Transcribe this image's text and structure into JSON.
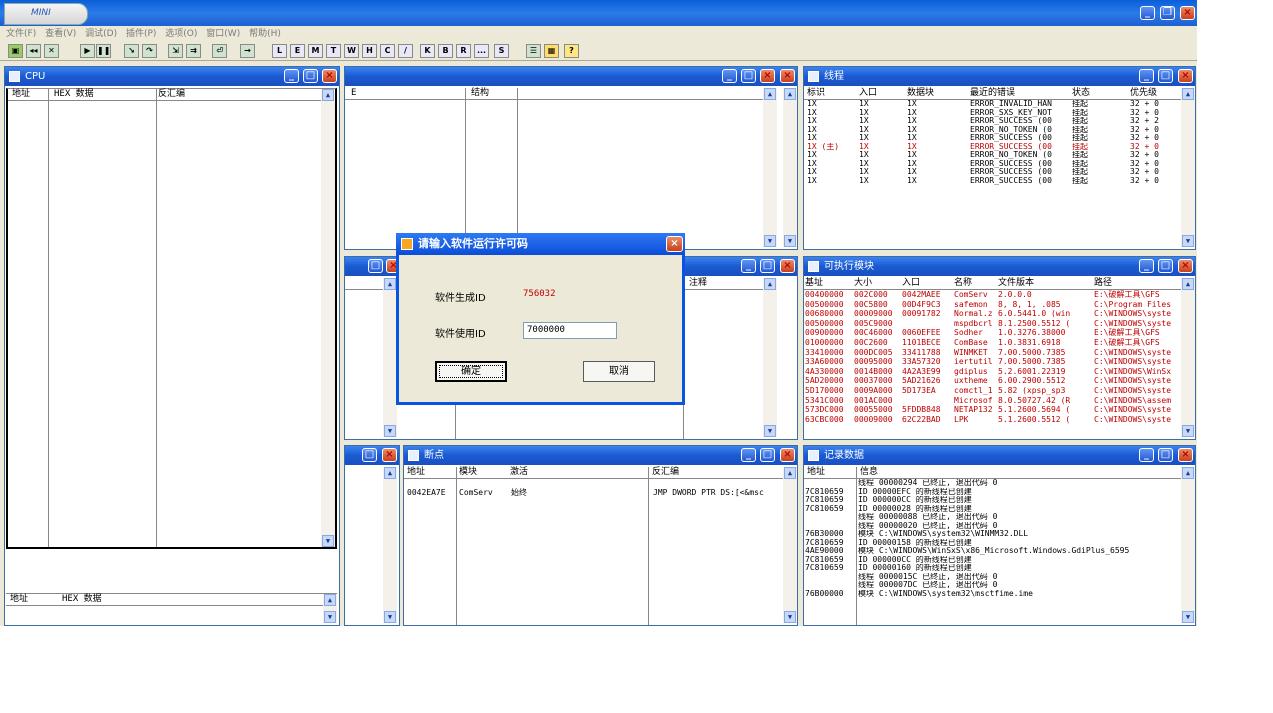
{
  "app": {
    "logo_text": "MINI"
  },
  "menu": [
    "文件(F)",
    "查看(V)",
    "调试(D)",
    "插件(P)",
    "选项(O)",
    "窗口(W)",
    "帮助(H)"
  ],
  "toolbar": [
    "L",
    "E",
    "M",
    "T",
    "W",
    "H",
    "C",
    "/",
    "K",
    "B",
    "R",
    "...",
    "S"
  ],
  "cpu": {
    "title": "CPU",
    "col_addr": "地址",
    "col_hex": "HEX 数据",
    "col_disasm": "反汇编",
    "dump_addr": "地址",
    "dump_hex": "HEX 数据"
  },
  "middle_top": {
    "col_a": "E",
    "col_b": "结构"
  },
  "middle_mid": {
    "col_a": "注释"
  },
  "threads": {
    "title": "线程",
    "cols": [
      "标识",
      "入口",
      "数据块",
      "最近的错误",
      "状态",
      "优先级"
    ],
    "rows": [
      [
        "1X",
        "1X",
        "1X",
        "ERROR_INVALID_HAN",
        "挂起",
        "32 + 0"
      ],
      [
        "1X",
        "1X",
        "1X",
        "ERROR_SXS_KEY_NOT",
        "挂起",
        "32 + 0"
      ],
      [
        "1X",
        "1X",
        "1X",
        "ERROR_SUCCESS (00",
        "挂起",
        "32 + 2"
      ],
      [
        "1X",
        "1X",
        "1X",
        "ERROR_NO_TOKEN (0",
        "挂起",
        "32 + 0"
      ],
      [
        "1X",
        "1X",
        "1X",
        "ERROR_SUCCESS (00",
        "挂起",
        "32 + 0"
      ],
      [
        "1X (主)",
        "1X",
        "1X",
        "ERROR_SUCCESS (00",
        "挂起",
        "32 + 0"
      ],
      [
        "1X",
        "1X",
        "1X",
        "ERROR_NO_TOKEN (0",
        "挂起",
        "32 + 0"
      ],
      [
        "1X",
        "1X",
        "1X",
        "ERROR_SUCCESS (00",
        "挂起",
        "32 + 0"
      ],
      [
        "1X",
        "1X",
        "1X",
        "ERROR_SUCCESS (00",
        "挂起",
        "32 + 0"
      ],
      [
        "1X",
        "1X",
        "1X",
        "ERROR_SUCCESS (00",
        "挂起",
        "32 + 0"
      ]
    ]
  },
  "modules": {
    "title": "可执行模块",
    "cols": [
      "基址",
      "大小",
      "入口",
      "名称",
      "文件版本",
      "路径"
    ],
    "rows": [
      [
        "00400000",
        "002C000",
        "0042MAEE",
        "ComServ",
        "2.0.0.0",
        "E:\\破解工具\\GFS"
      ],
      [
        "00500000",
        "00C5800",
        "00D4F9C3",
        "safemon",
        "8, 8, 1, .085",
        "C:\\Program Files"
      ],
      [
        "00680000",
        "00009000",
        "00091782",
        "Normal.z",
        "6.0.5441.0 (win",
        "C:\\WINDOWS\\syste"
      ],
      [
        "00500000",
        "005C9000",
        "",
        "mspdbcrl",
        "8.1.2500.5512 (",
        "C:\\WINDOWS\\syste"
      ],
      [
        "00900000",
        "00C46000",
        "0060EFEE",
        "Sodher",
        "1.0.3276.38000",
        "E:\\破解工具\\GFS"
      ],
      [
        "01000000",
        "00C2600",
        "1101BECE",
        "ComBase",
        "1.0.3831.6918",
        "E:\\破解工具\\GFS"
      ],
      [
        "33410000",
        "000DC005",
        "33411788",
        "WINMKET",
        "7.00.5000.7385",
        "C:\\WINDOWS\\syste"
      ],
      [
        "33A60000",
        "00095000",
        "33A57320",
        "iertutil",
        "7.00.5000.7385",
        "C:\\WINDOWS\\syste"
      ],
      [
        "4A330000",
        "0014B000",
        "4A2A3E99",
        "gdiplus",
        "5.2.6001.22319",
        "C:\\WINDOWS\\WinSx"
      ],
      [
        "5AD20000",
        "00037000",
        "5AD21626",
        "uxtheme",
        "6.00.2900.5512",
        "C:\\WINDOWS\\syste"
      ],
      [
        "5D170000",
        "0009A000",
        "5D173EA",
        "comctl_1",
        "5.82 (xpsp_sp3",
        "C:\\WINDOWS\\syste"
      ],
      [
        "5341C000",
        "001AC000",
        "",
        "Microsof",
        "8.0.50727.42 (R",
        "C:\\WINDOWS\\assem"
      ],
      [
        "573DC000",
        "00055000",
        "5FDDB848",
        "NETAP132",
        "5.1.2600.5694 (",
        "C:\\WINDOWS\\syste"
      ],
      [
        "63CBC000",
        "00009000",
        "62C22BAD",
        "LPK",
        "5.1.2600.5512 (",
        "C:\\WINDOWS\\syste"
      ]
    ]
  },
  "breakpoints": {
    "title": "断点",
    "cols": [
      "地址",
      "模块",
      "激活",
      "反汇编"
    ],
    "rows": [
      [
        "0042EA7E",
        "ComServ",
        "始终",
        "JMP DWORD PTR DS:[<&msc"
      ]
    ]
  },
  "log": {
    "title": "记录数据",
    "cols": [
      "地址",
      "信息"
    ],
    "rows": [
      [
        "",
        "线程 00000294 已终止, 退出代码 0"
      ],
      [
        "7C810659",
        "ID 00000EFC 的新线程已创建"
      ],
      [
        "7C810659",
        "ID 000000CC 的新线程已创建"
      ],
      [
        "7C810659",
        "ID 00000028 的新线程已创建"
      ],
      [
        "",
        "线程 00000088 已终止, 退出代码 0"
      ],
      [
        "",
        "线程 00000020 已终止, 退出代码 0"
      ],
      [
        "76B30000",
        "模块 C:\\WINDOWS\\system32\\WINMM32.DLL"
      ],
      [
        "7C810659",
        "ID 00000158 的新线程已创建"
      ],
      [
        "4AE90000",
        "模块 C:\\WINDOWS\\WinSxS\\x86_Microsoft.Windows.GdiPlus_6595"
      ],
      [
        "7C810659",
        "ID 000000CC 的新线程已创建"
      ],
      [
        "7C810659",
        "ID 00000160 的新线程已创建"
      ],
      [
        "",
        "线程 0000015C 已终止, 退出代码 0"
      ],
      [
        "",
        "线程 000007DC 已终止, 退出代码 0"
      ],
      [
        "76B00000",
        "模块 C:\\WINDOWS\\system32\\msctfime.ime"
      ]
    ]
  },
  "dialog": {
    "title": "请输入软件运行许可码",
    "machine_label": "软件生成ID",
    "machine_id": "756032",
    "use_label": "软件使用ID",
    "use_value": "7000000",
    "ok": "确定",
    "cancel": "取消"
  },
  "colors": {
    "accent": "#0a55e0",
    "red_text": "#c00000"
  }
}
